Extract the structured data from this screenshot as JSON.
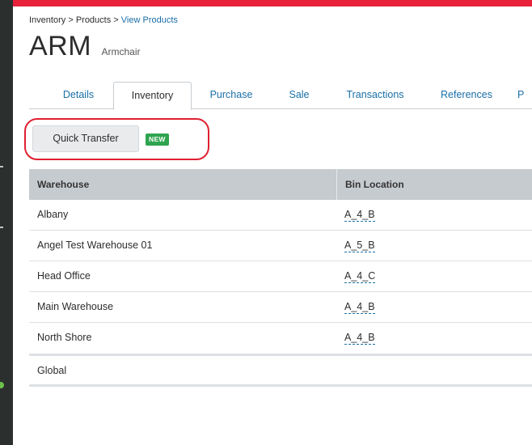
{
  "breadcrumb": {
    "item1": "Inventory",
    "sep": ">",
    "item2": "Products",
    "item3": "View Products"
  },
  "product": {
    "code": "ARM",
    "name": "Armchair"
  },
  "tabs": [
    {
      "label": "Details"
    },
    {
      "label": "Inventory"
    },
    {
      "label": "Purchase"
    },
    {
      "label": "Sale"
    },
    {
      "label": "Transactions"
    },
    {
      "label": "References"
    },
    {
      "label": "P"
    }
  ],
  "active_tab": "Inventory",
  "quick_transfer": {
    "label": "Quick Transfer",
    "badge": "NEW"
  },
  "table": {
    "headers": [
      "Warehouse",
      "Bin Location"
    ],
    "rows": [
      {
        "warehouse": "Albany",
        "bin": "A_4_B"
      },
      {
        "warehouse": "Angel Test Warehouse 01",
        "bin": "A_5_B"
      },
      {
        "warehouse": "Head Office",
        "bin": "A_4_C"
      },
      {
        "warehouse": "Main Warehouse",
        "bin": "A_4_B"
      },
      {
        "warehouse": "North Shore",
        "bin": "A_4_B"
      }
    ],
    "footer": {
      "warehouse": "Global",
      "bin": ""
    }
  },
  "colors": {
    "brand_red": "#e8213b",
    "link_blue": "#1a6fa8",
    "badge_green": "#2fa44f",
    "header_gray": "#c6cbd0"
  }
}
